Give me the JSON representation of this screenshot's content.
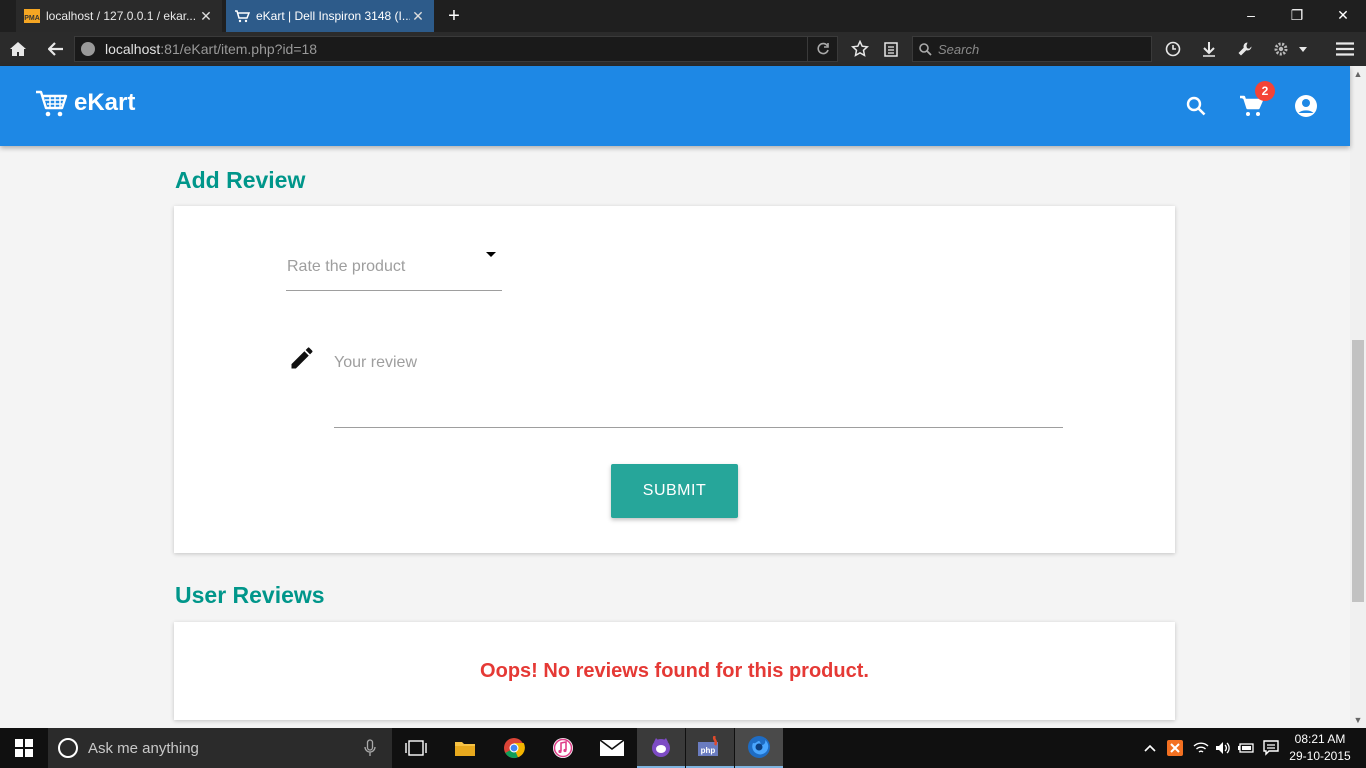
{
  "browser": {
    "tabs": [
      {
        "title": "localhost / 127.0.0.1 / ekar...",
        "active": false
      },
      {
        "title": "eKart | Dell Inspiron 3148 (I...",
        "active": true
      }
    ],
    "url_host": "localhost",
    "url_rest": ":81/eKart/item.php?id=18",
    "search_placeholder": "Search"
  },
  "header": {
    "brand": "eKart",
    "cart_count": "2",
    "color": "#1e88e5"
  },
  "add_review": {
    "title": "Add Review",
    "rating_placeholder": "Rate the product",
    "review_placeholder": "Your review",
    "submit_label": "SUBMIT"
  },
  "user_reviews": {
    "title": "User Reviews",
    "empty_message": "Oops! No reviews found for this product."
  },
  "taskbar": {
    "cortana_placeholder": "Ask me anything",
    "time": "08:21 AM",
    "date": "29-10-2015"
  },
  "colors": {
    "accent_teal": "#00968a",
    "button_teal": "#26a69a",
    "error_red": "#e53935"
  }
}
